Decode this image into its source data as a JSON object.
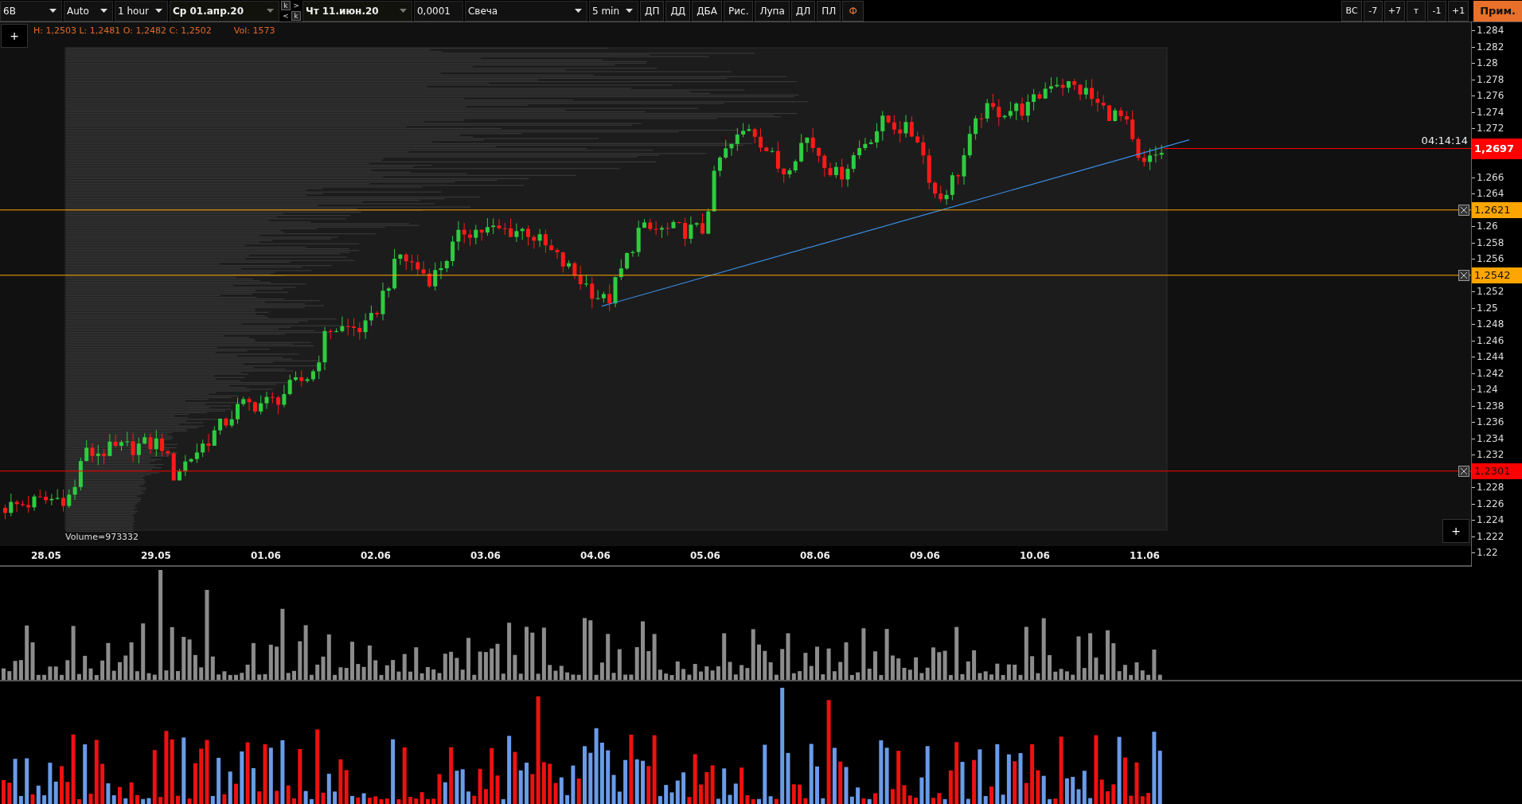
{
  "toolbar": {
    "items": [
      {
        "kind": "dropdown",
        "label": "6B"
      },
      {
        "kind": "dropdown",
        "label": "Auto"
      },
      {
        "kind": "dropdown",
        "label": "1 hour"
      },
      {
        "kind": "date",
        "label": "Ср 01.апр.20"
      },
      {
        "kind": "stepper",
        "labels": [
          "k",
          ">",
          "<",
          "k"
        ]
      },
      {
        "kind": "date",
        "label": "Чт 11.июн.20"
      },
      {
        "kind": "field",
        "label": "0,0001"
      },
      {
        "kind": "wide",
        "label": "Свеча"
      },
      {
        "kind": "dropdown",
        "label": "5 min"
      },
      {
        "kind": "button",
        "label": "ДП",
        "accent": false
      },
      {
        "kind": "button",
        "label": "ДД",
        "accent": false
      },
      {
        "kind": "button",
        "label": "ДБА",
        "accent": false
      },
      {
        "kind": "button",
        "label": "Рис.",
        "accent": false
      },
      {
        "kind": "button",
        "label": "Лупа",
        "accent": false
      },
      {
        "kind": "button",
        "label": "ДЛ",
        "accent": false
      },
      {
        "kind": "button",
        "label": "ПЛ",
        "accent": false
      },
      {
        "kind": "button",
        "label": "Ф",
        "accent": true
      }
    ],
    "right_buttons": [
      "ВС",
      "-7",
      "+7",
      "т",
      "-1",
      "+1"
    ],
    "notes_button": "Прим."
  },
  "legend": {
    "ohlc": "H: 1,2503 L: 1,2481 O: 1,2482 C: 1,2502",
    "volume": "Vol: 1573"
  },
  "add_buttons": [
    "+",
    "+"
  ],
  "profile_label": "Volume=973332",
  "price_axis": {
    "items": [
      {
        "kind": "tick",
        "label": "1.284"
      },
      {
        "kind": "tick",
        "label": "1.282"
      },
      {
        "kind": "tick",
        "label": "1.28"
      },
      {
        "kind": "tick",
        "label": "1.278"
      },
      {
        "kind": "tick",
        "label": "1.276"
      },
      {
        "kind": "tick",
        "label": "1.274"
      },
      {
        "kind": "tick",
        "label": "1.272"
      },
      {
        "kind": "current",
        "label": "1,2697",
        "color": "#ff0000",
        "timer": "04:14:14"
      },
      {
        "kind": "tick",
        "label": "1.266"
      },
      {
        "kind": "tick",
        "label": "1.264"
      },
      {
        "kind": "level",
        "label": "1,2621",
        "color": "#ffa500"
      },
      {
        "kind": "tick",
        "label": "1.26"
      },
      {
        "kind": "tick",
        "label": "1.258"
      },
      {
        "kind": "tick",
        "label": "1.256"
      },
      {
        "kind": "level",
        "label": "1,2542",
        "color": "#ffa500"
      },
      {
        "kind": "tick",
        "label": "1.252"
      },
      {
        "kind": "tick",
        "label": "1.25"
      },
      {
        "kind": "tick",
        "label": "1.248"
      },
      {
        "kind": "tick",
        "label": "1.246"
      },
      {
        "kind": "tick",
        "label": "1.244"
      },
      {
        "kind": "tick",
        "label": "1.242"
      },
      {
        "kind": "tick",
        "label": "1.24"
      },
      {
        "kind": "tick",
        "label": "1.238"
      },
      {
        "kind": "tick",
        "label": "1.236"
      },
      {
        "kind": "tick",
        "label": "1.234"
      },
      {
        "kind": "tick",
        "label": "1.232"
      },
      {
        "kind": "level",
        "label": "1,2301",
        "color": "#ff0000"
      },
      {
        "kind": "tick",
        "label": "1.228"
      },
      {
        "kind": "tick",
        "label": "1.226"
      },
      {
        "kind": "tick",
        "label": "1.224"
      },
      {
        "kind": "tick",
        "label": "1.222"
      },
      {
        "kind": "tick",
        "label": "1.22"
      }
    ]
  },
  "date_axis": [
    "28.05",
    "29.05",
    "01.06",
    "02.06",
    "03.06",
    "04.06",
    "05.06",
    "08.06",
    "09.06",
    "10.06",
    "11.06"
  ]
}
